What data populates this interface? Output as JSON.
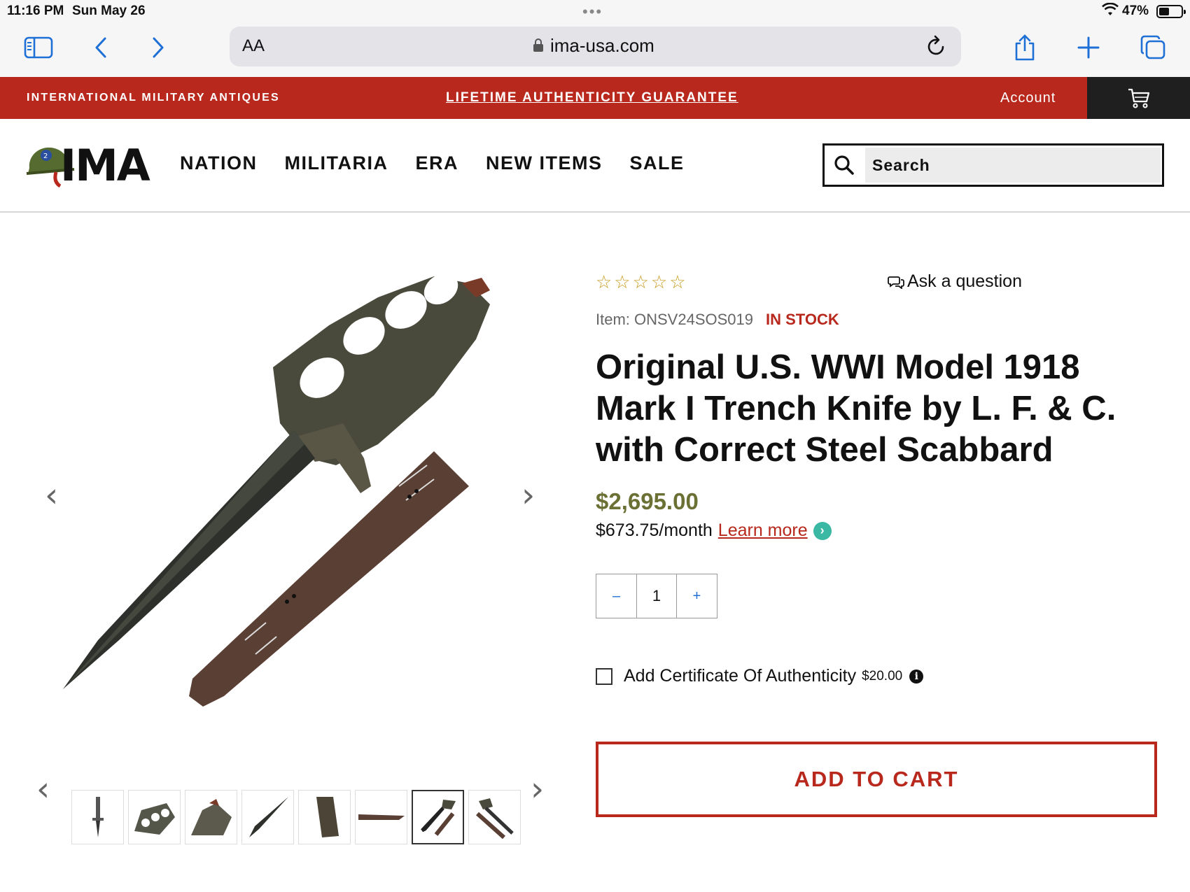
{
  "status": {
    "time": "11:16 PM",
    "date": "Sun May 26",
    "battery_pct": "47%",
    "battery_level": 0.47
  },
  "browser": {
    "aa_label": "AA",
    "domain": "ima-usa.com"
  },
  "promo": {
    "brand": "INTERNATIONAL MILITARY ANTIQUES",
    "guarantee": "LIFETIME AUTHENTICITY GUARANTEE",
    "account": "Account"
  },
  "header": {
    "logo_text": "IMA",
    "nav": [
      "NATION",
      "MILITARIA",
      "ERA",
      "NEW ITEMS",
      "SALE"
    ],
    "search_placeholder": "Search"
  },
  "gallery": {
    "thumb_count": 8,
    "active_thumb": 7
  },
  "product": {
    "stars": "☆☆☆☆☆",
    "ask": "Ask a question",
    "item": "Item: ONSV24SOS019",
    "stock": "IN STOCK",
    "title": "Original U.S. WWI Model 1918 Mark I Trench Knife by L. F. & C. with Correct Steel Scabbard",
    "price": "$2,695.00",
    "monthly": "$673.75/month",
    "learn_more": "Learn more",
    "qty_minus": "–",
    "qty_value": "1",
    "qty_plus": "+",
    "coa_label": "Add Certificate Of Authenticity",
    "coa_fee": "$20.00",
    "add_to_cart": "ADD TO CART"
  },
  "colors": {
    "brand_red": "#b8281c",
    "price_olive": "#6b7134",
    "star_gold": "#c99b20",
    "ios_blue": "#1e6fd6"
  }
}
